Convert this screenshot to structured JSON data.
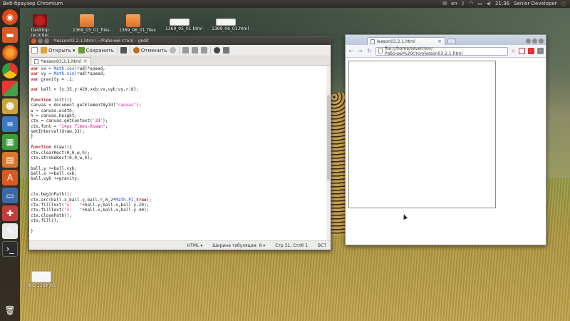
{
  "top_panel": {
    "app_title": "Веб-браузер Chromium",
    "keyboard_layout": "en",
    "clock": "21:36",
    "user": "Senior Developer",
    "icons": [
      "mail-icon",
      "bluetooth-icon",
      "wifi-icon",
      "battery-icon",
      "volume-icon"
    ]
  },
  "desktop": {
    "icons": [
      {
        "label": "Desktop recorder",
        "icon": "recorder-icon"
      },
      {
        "label": "1369_05_01_files",
        "icon": "folder-icon"
      },
      {
        "label": "1369_06_01_files",
        "icon": "folder-icon"
      },
      {
        "label": "1369_05_01.html",
        "icon": "html-file-icon"
      },
      {
        "label": "1369_06_01.html",
        "icon": "html-file-icon"
      },
      {
        "label": "005 1369_05",
        "icon": "html-file-icon"
      }
    ]
  },
  "gedit": {
    "title": "*lesson03.2.1.html (~/Рабочий стол) - gedit",
    "toolbar": {
      "open_label": "Открыть",
      "save_label": "Сохранить",
      "undo_label": "Отменить"
    },
    "tab_label": "*lesson03.2.1.html",
    "code_lines": [
      "var vx = Math.cos(rad)*speed;",
      "var vy = Math.sin(rad)*speed;",
      "var gravity = .1;",
      "",
      "var ball = {x:35,y:420,vxb:vx,vyb:vy,r:8};",
      "",
      "function init(){",
      "canvas = document.getElementById(\"canvas\");",
      "w = canvas.width;",
      "h = canvas.height;",
      "ctx = canvas.getContext('2d');",
      "ctx.font = \"14px Times-Roman\";",
      "setInterval(draw,33);",
      "}",
      "",
      "function draw(){",
      "ctx.clearRect(0,0,w,h);",
      "ctx.strokeRect(0,0,w,h);",
      "",
      "ball.y +=ball.vyb;",
      "ball.x +=ball.vxb;",
      "ball.vyb +=gravity;",
      "",
      "",
      "ctx.beginPath();",
      "ctx.arc(ball.x,ball.y,ball.r,0,2*Math.PI,true);",
      "ctx.fillText(\"y:   \"+ball.y,ball.x,ball.y-20);",
      "ctx.fillText(\"x:   \"+ball.x,ball.x,ball.y-40);",
      "ctx.closePath();",
      "ctx.fill();",
      "",
      "}"
    ],
    "status": {
      "language": "HTML",
      "tab_width": "Ширина табуляции: 8",
      "position": "Стр 31, Стлб 1",
      "mode": "ВСТ"
    }
  },
  "chromium": {
    "tab_label": "lesson03.2.1.html",
    "url": "file:///home/severinov/Рабочий%20стол/lesson03.2.1.html"
  }
}
